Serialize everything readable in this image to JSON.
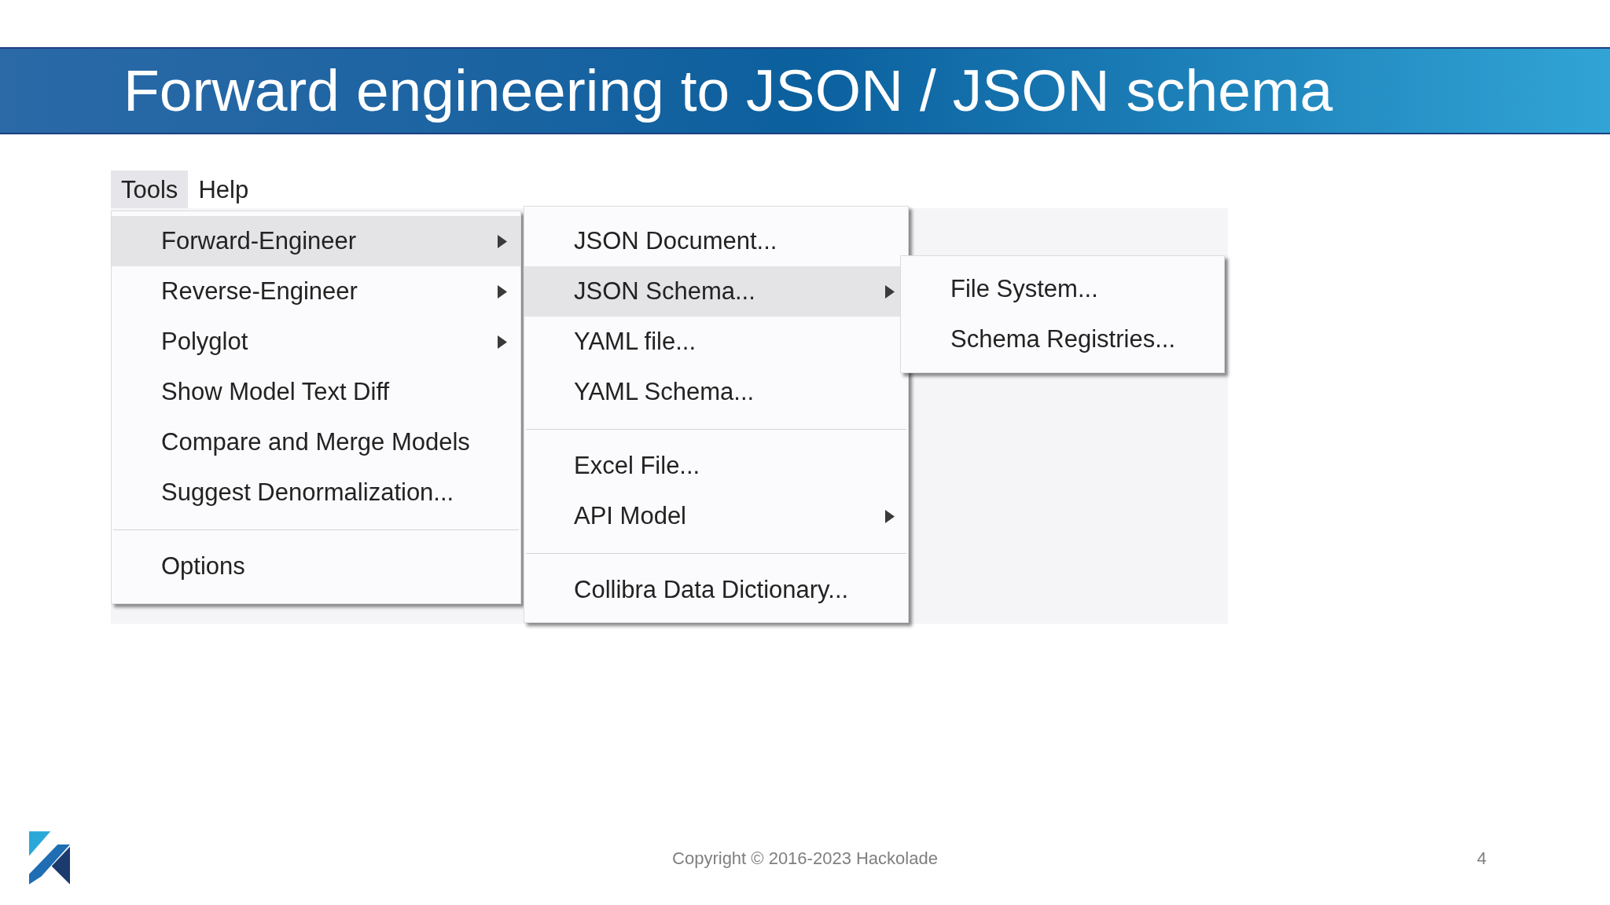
{
  "slide": {
    "title": "Forward engineering to JSON / JSON schema",
    "footer": {
      "copyright": "Copyright © 2016-2023 Hackolade",
      "page_number": "4"
    }
  },
  "menubar": [
    {
      "label": "Tools",
      "selected": true
    },
    {
      "label": "Help",
      "selected": false
    }
  ],
  "menus": [
    {
      "items": [
        {
          "kind": "item",
          "label": "Forward-Engineer",
          "submenu": true,
          "selected": true
        },
        {
          "kind": "item",
          "label": "Reverse-Engineer",
          "submenu": true,
          "selected": false
        },
        {
          "kind": "item",
          "label": "Polyglot",
          "submenu": true,
          "selected": false
        },
        {
          "kind": "item",
          "label": "Show Model Text Diff",
          "submenu": false,
          "selected": false
        },
        {
          "kind": "item",
          "label": "Compare and Merge Models",
          "submenu": false,
          "selected": false
        },
        {
          "kind": "item",
          "label": "Suggest Denormalization...",
          "submenu": false,
          "selected": false
        },
        {
          "kind": "separator"
        },
        {
          "kind": "item",
          "label": "Options",
          "submenu": false,
          "selected": false
        }
      ]
    },
    {
      "items": [
        {
          "kind": "item",
          "label": "JSON Document...",
          "submenu": false,
          "selected": false
        },
        {
          "kind": "item",
          "label": "JSON Schema...",
          "submenu": true,
          "selected": true
        },
        {
          "kind": "item",
          "label": "YAML file...",
          "submenu": false,
          "selected": false
        },
        {
          "kind": "item",
          "label": "YAML Schema...",
          "submenu": false,
          "selected": false
        },
        {
          "kind": "separator"
        },
        {
          "kind": "item",
          "label": "Excel File...",
          "submenu": false,
          "selected": false
        },
        {
          "kind": "item",
          "label": "API Model",
          "submenu": true,
          "selected": false
        },
        {
          "kind": "separator"
        },
        {
          "kind": "item",
          "label": "Collibra Data Dictionary...",
          "submenu": false,
          "selected": false
        }
      ]
    },
    {
      "items": [
        {
          "kind": "item",
          "label": "File System...",
          "submenu": false,
          "selected": false
        },
        {
          "kind": "item",
          "label": "Schema Registries...",
          "submenu": false,
          "selected": false
        }
      ]
    }
  ]
}
